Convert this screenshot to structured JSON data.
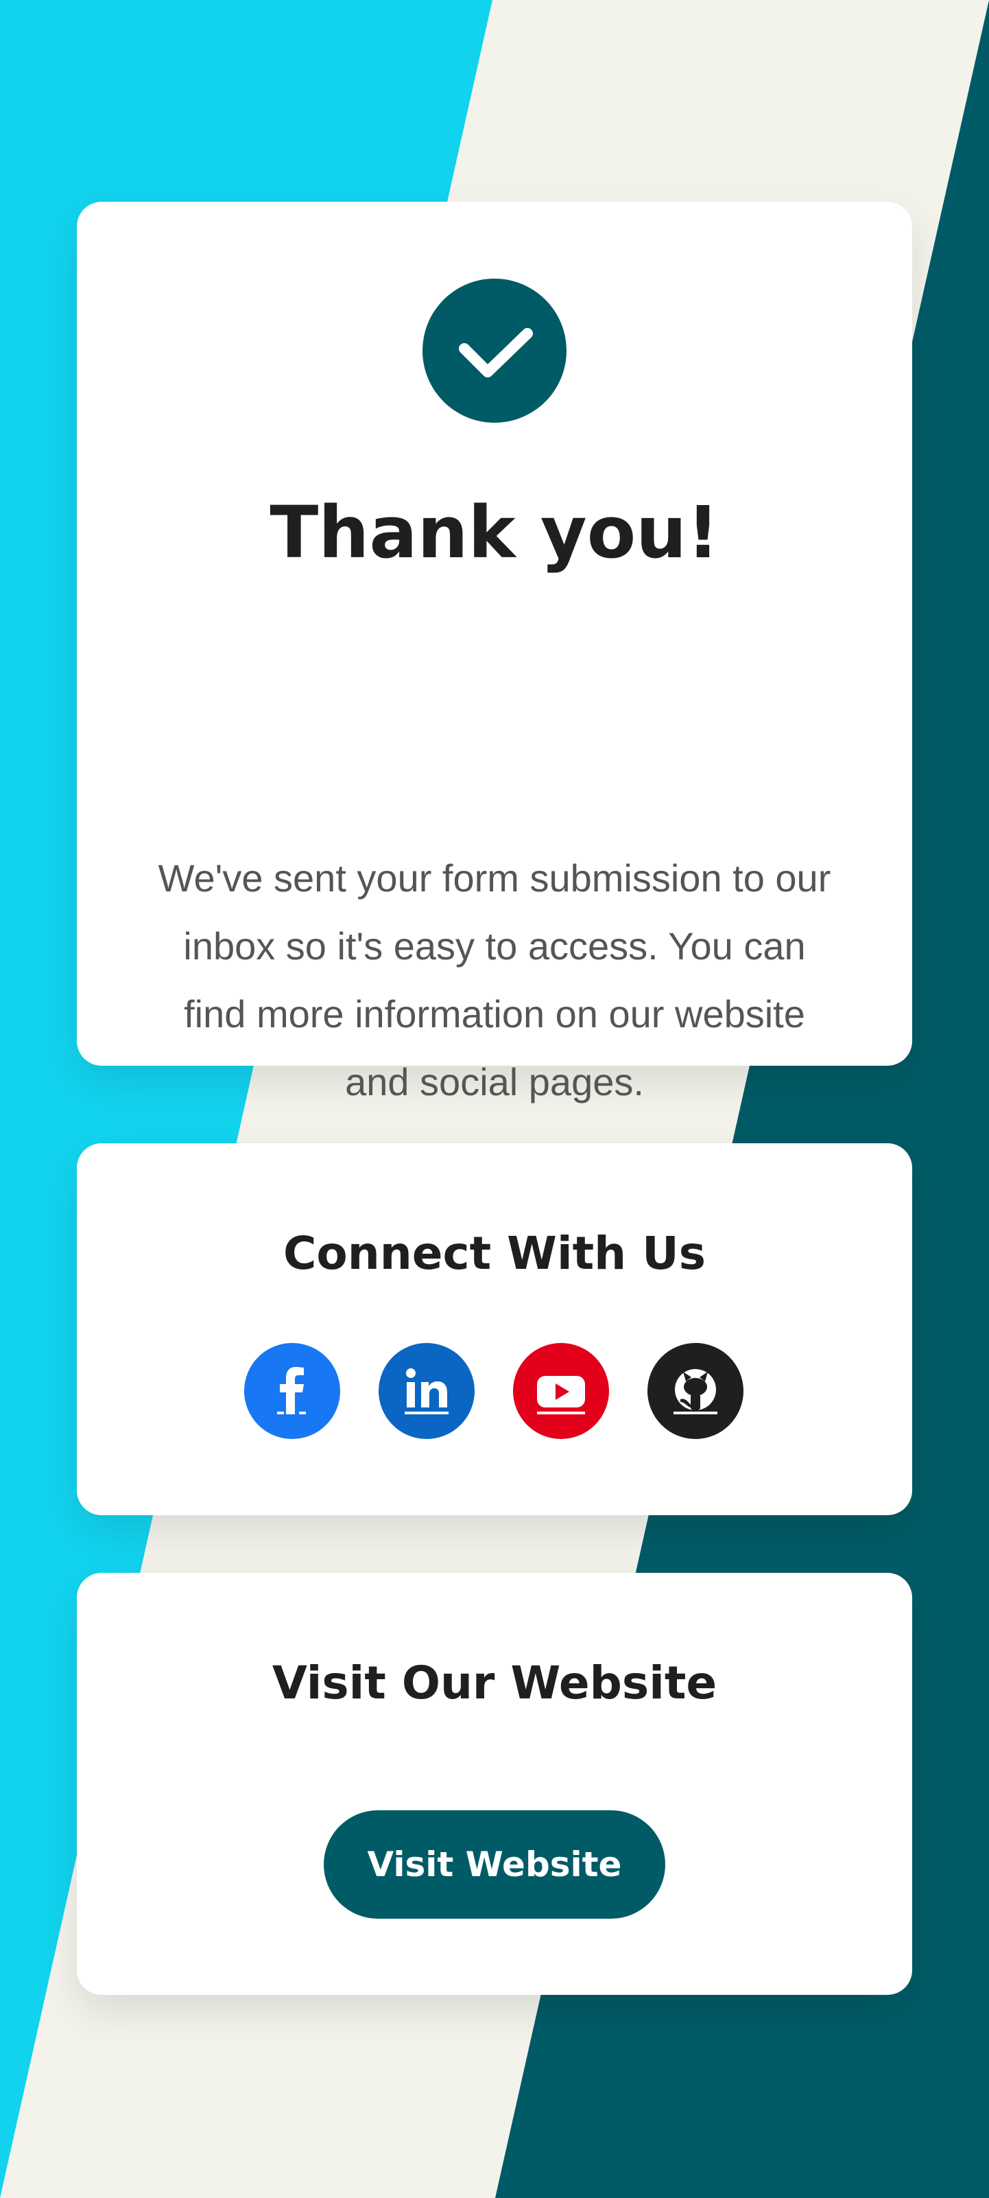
{
  "colors": {
    "cyan": "#12d3ee",
    "beige": "#f3f3ec",
    "teal": "#015b66",
    "card": "#ffffff",
    "heading": "#1f1f1f",
    "body_text": "#555555"
  },
  "thanks_card": {
    "icon": "checkmark-icon",
    "title": "Thank you!",
    "message": "We've sent your form submission to our inbox so it's easy to access. You can find more information on our website and social pages."
  },
  "connect_card": {
    "title": "Connect With Us",
    "socials": [
      {
        "name": "Facebook",
        "icon": "facebook-icon",
        "color": "#1877f2"
      },
      {
        "name": "LinkedIn",
        "icon": "linkedin-icon",
        "color": "#0a66c2"
      },
      {
        "name": "YouTube",
        "icon": "youtube-icon",
        "color": "#e3001b"
      },
      {
        "name": "GitHub",
        "icon": "github-icon",
        "color": "#1f1f1f"
      }
    ]
  },
  "visit_card": {
    "title": "Visit Our Website",
    "button_label": "Visit Website"
  }
}
